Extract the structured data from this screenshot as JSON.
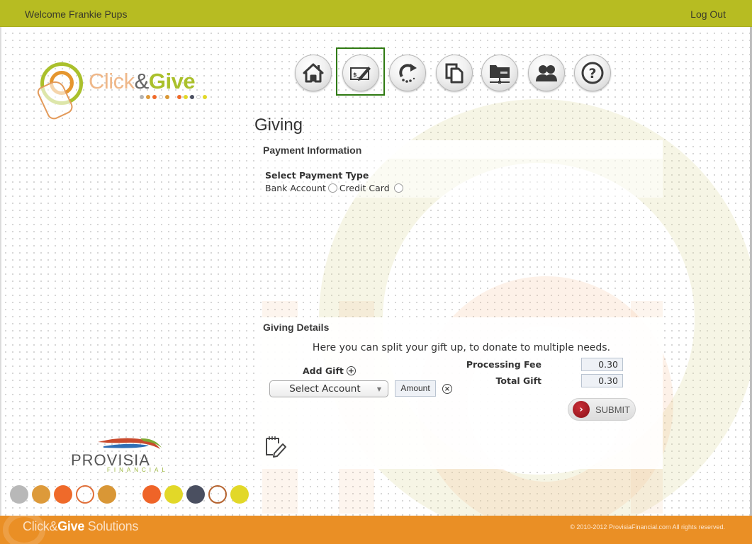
{
  "header": {
    "welcome": "Welcome Frankie Pups",
    "logout": "Log Out",
    "bar_color": "#b7bc22"
  },
  "logo": {
    "part1": "Click",
    "amp": "&",
    "part2": "Give",
    "dot_colors": [
      "#b3b3b3",
      "#dd9a3a",
      "#ef6a2a",
      "#ffffff",
      "#d99736",
      "#ef6a2a",
      "#e2d828",
      "#4a4f60",
      "#ffffff",
      "#e2d828"
    ]
  },
  "nav": {
    "items": [
      {
        "name": "home",
        "icon": "home-icon",
        "selected": false
      },
      {
        "name": "giving",
        "icon": "check-pen-icon",
        "selected": true
      },
      {
        "name": "recurring",
        "icon": "refresh-arrow-icon",
        "selected": false
      },
      {
        "name": "history",
        "icon": "copy-documents-icon",
        "selected": false
      },
      {
        "name": "accounts",
        "icon": "network-folder-icon",
        "selected": false
      },
      {
        "name": "profile",
        "icon": "users-icon",
        "selected": false
      },
      {
        "name": "help",
        "icon": "question-icon",
        "selected": false
      }
    ],
    "selected_border_color": "#2f7a12"
  },
  "page": {
    "title": "Giving"
  },
  "payment": {
    "section_title": "Payment Information",
    "select_label": "Select Payment Type",
    "options": [
      {
        "label": "Bank Account",
        "checked": false
      },
      {
        "label": "Credit Card",
        "checked": false
      }
    ]
  },
  "giving": {
    "section_title": "Giving Details",
    "intro": "Here you can split your gift up, to donate to multiple needs.",
    "add_gift_label": "Add Gift",
    "add_gift_icon": "+",
    "select_account": "Select Account",
    "select_caret": "▼",
    "amount_placeholder": "Amount",
    "remove_icon": "×",
    "processing_fee_label": "Processing Fee",
    "processing_fee_value": "0.30",
    "total_gift_label": "Total Gift",
    "total_gift_value": "0.30",
    "submit_label": "SUBMIT",
    "submit_arrow": "›"
  },
  "partner": {
    "name": "PROVISIA",
    "sub": "FINANCIAL"
  },
  "swatches": [
    "#b8b8b8",
    "#dd9a3a",
    "#ef6a2a",
    "ring:#e0703a",
    "#d99736",
    "#ef6428",
    "#e2d828",
    "#4a4f60",
    "ring:#b5632f",
    "#e2d828"
  ],
  "footer": {
    "brand_part1": "Click&",
    "brand_part2": "Give",
    "brand_part3": " Solutions",
    "copyright": "© 2010-2012 ProvisiaFinancial.com   All rights reserved.",
    "bar_color": "#ea8f25"
  }
}
